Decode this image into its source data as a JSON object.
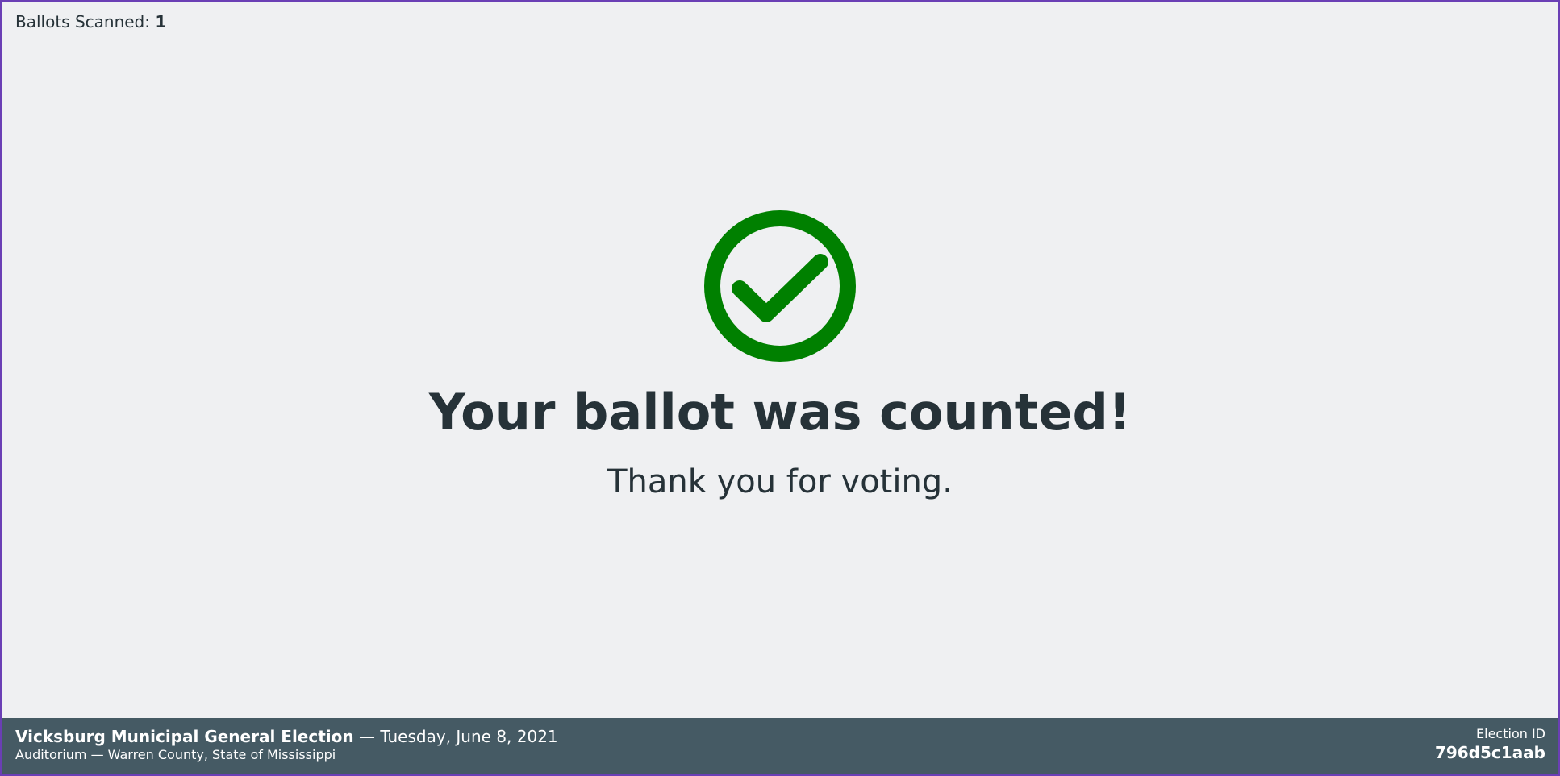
{
  "status": {
    "ballots_scanned_label": "Ballots Scanned:",
    "ballots_scanned_count": "1"
  },
  "main": {
    "icon": "check-circle-icon",
    "icon_color": "#008000",
    "headline": "Your ballot was counted!",
    "subline": "Thank you for voting."
  },
  "footer": {
    "election_title": "Vicksburg Municipal General Election",
    "election_date": " — Tuesday, June 8, 2021",
    "location": "Auditorium — Warren County, State of Mississippi",
    "election_id_label": "Election ID",
    "election_id": "796d5c1aab",
    "background_color": "#455a64"
  }
}
